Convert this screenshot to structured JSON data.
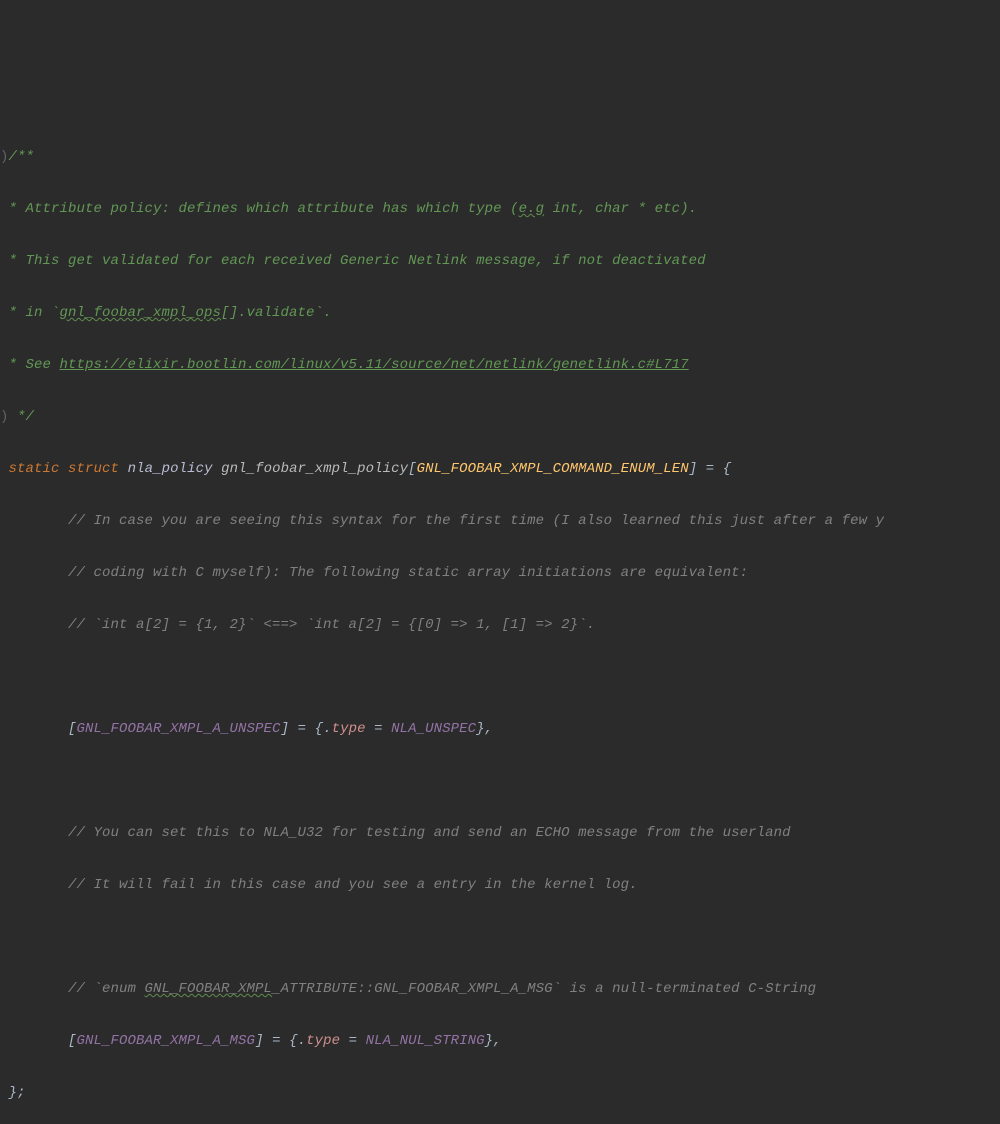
{
  "c": {
    "open": "/**",
    "l1a": " * Attribute policy: defines which attribute has which type (",
    "l1b": "e.g",
    "l1c": " int, char * etc).",
    "l2": " * This get validated for each received Generic Netlink message, if not deactivated",
    "l3a": " * in `",
    "l3b": "gnl_foobar_xmpl_ops",
    "l3c": "[].validate`.",
    "l4a": " * See ",
    "l4b": "https://elixir.bootlin.com/linux/v5.11/source/net/netlink/genetlink.c#L717",
    "close": " */"
  },
  "gutterFrag": ")",
  "decl": {
    "kw_static": "static",
    "kw_struct": "struct",
    "type": "nla_policy",
    "name": "gnl_foobar_xmpl_policy",
    "sizeMacro": "GNL_FOOBAR_XMPL_COMMAND_ENUM_LEN",
    "openBracket": "[",
    "closeBracket": "]",
    "eq": " = ",
    "openBrace": "{"
  },
  "lc": {
    "l1": "// In case you are seeing this syntax for the first time (I also learned this just after a few y",
    "l2": "// coding with C myself): The following static array initiations are equivalent:",
    "l3": "// `int a[2] = {1, 2}` <==> `int a[2] = {[0] => 1, [1] => 2}`.",
    "l4": "// You can set this to NLA_U32 for testing and send an ECHO message from the userland",
    "l5": "// It will fail in this case and you see a entry in the kernel log.",
    "l6a": "// `enum ",
    "l6b": "GNL_FOOBAR_XMPL",
    "l6c": "_ATTRIBUTE::GNL_FOOBAR_XMPL_A_MSG` is a null-terminated C-String"
  },
  "entry1": {
    "idx": "GNL_FOOBAR_XMPL_A_UNSPEC",
    "field": "type",
    "val": "NLA_UNSPEC"
  },
  "entry2": {
    "idx": "GNL_FOOBAR_XMPL_A_MSG",
    "field": "type",
    "val": "NLA_NUL_STRING"
  },
  "closeBrace": "};",
  "indent": "        ",
  "padMain": " "
}
